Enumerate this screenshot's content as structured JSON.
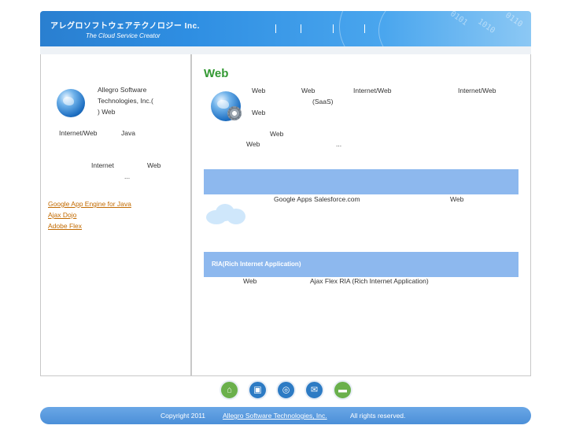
{
  "header": {
    "brand": "アレグロソフトウェアテクノロジー Inc.",
    "tagline": "The Cloud Service Creator",
    "digits_a": "0101",
    "digits_b": "1010",
    "digits_c": "0110"
  },
  "sidebar": {
    "intro_line1": "Allegro Software",
    "intro_line2": "Technologies, Inc.(",
    "intro_line3": ") Web",
    "p1_a": "Internet/Web",
    "p1_b": "Java",
    "p2_a": "Internet",
    "p2_b": "Web",
    "p2_c": "...",
    "links": [
      "Google App Engine for Java",
      "Ajax Dojo",
      "Adobe Flex"
    ]
  },
  "content": {
    "title": "Web",
    "intro_web1": "Web",
    "intro_web2": "Web",
    "intro_internet1": "Internet/Web",
    "intro_internet2": "Internet/Web",
    "intro_saas": "(SaaS)",
    "intro_web3": "Web",
    "intro_web4": "Web",
    "intro_web5": "Web",
    "intro_ellipsis": "...",
    "section1_label": "",
    "section1_text_a": "Google Apps Salesforce.com",
    "section1_text_b": "Web",
    "section2_label": "RIA(Rich Internet Application)",
    "section2_text_a": "Web",
    "section2_text_b": "Ajax Flex  RIA  (Rich Internet Application)"
  },
  "footer": {
    "buttons": [
      {
        "icon": "home-icon",
        "color": "#6ab04c",
        "glyph": "⌂"
      },
      {
        "icon": "monitor-icon",
        "color": "#2d7bc4",
        "glyph": "▣"
      },
      {
        "icon": "globe-icon",
        "color": "#2d7bc4",
        "glyph": "◎"
      },
      {
        "icon": "mail-icon",
        "color": "#2d7bc4",
        "glyph": "✉"
      },
      {
        "icon": "chat-icon",
        "color": "#6ab04c",
        "glyph": "▬"
      }
    ],
    "copyright": "Copyright 2011",
    "company_link": "Allegro Software Technologies, Inc.",
    "rights": "All rights reserved."
  },
  "colors": {
    "accent_green": "#339933",
    "link_orange": "#c26a00",
    "band_blue": "#8db8ee"
  }
}
